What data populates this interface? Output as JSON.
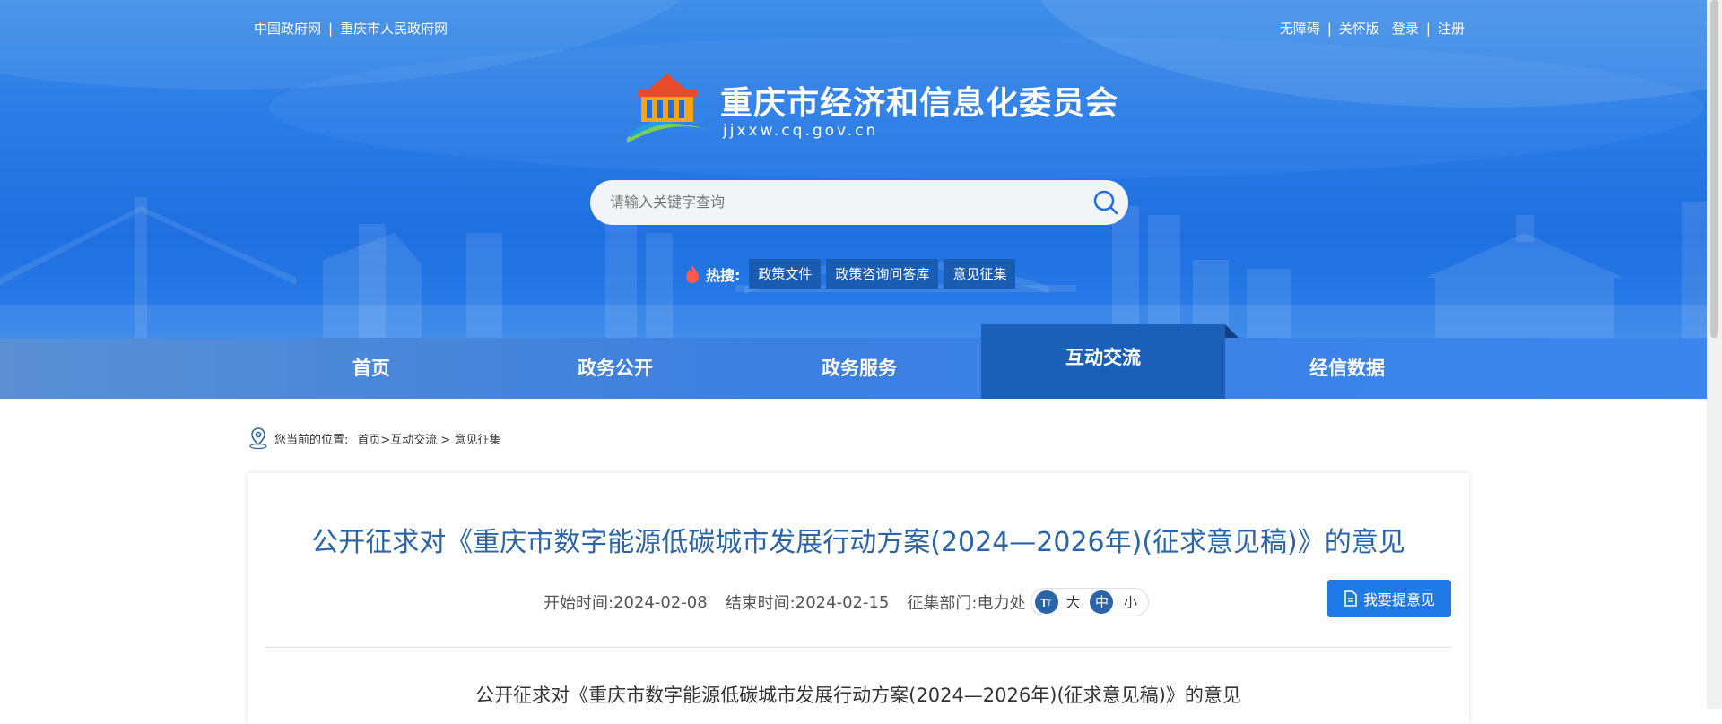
{
  "top_left_links": [
    "中国政府网",
    "重庆市人民政府网"
  ],
  "top_left_sep": "|",
  "top_right_links": [
    "无障碍",
    "关怀版",
    "登录",
    "注册"
  ],
  "site": {
    "title": "重庆市经济和信息化委员会",
    "domain": "jjxxw.cq.gov.cn"
  },
  "search": {
    "placeholder": "请输入关键字查询"
  },
  "hot": {
    "label": "热搜:",
    "tags": [
      "政策文件",
      "政策咨询问答库",
      "意见征集"
    ]
  },
  "nav": {
    "items": [
      "首页",
      "政务公开",
      "政务服务",
      "互动交流",
      "经信数据"
    ],
    "active_index": 3
  },
  "breadcrumb": {
    "prefix": "您当前的位置:",
    "path": "首页>互动交流 > 意见征集"
  },
  "article": {
    "title": "公开征求对《重庆市数字能源低碳城市发展行动方案(2024—2026年)(征求意见稿)》的意见",
    "start_label": "开始时间:",
    "start_value": "2024-02-08",
    "end_label": "结束时间:",
    "end_value": "2024-02-15",
    "dept_label": "征集部门:",
    "dept_value": "电力处",
    "font_sizes": [
      "大",
      "中",
      "小"
    ],
    "font_active": "中",
    "submit_label": "我要提意见",
    "body_title": "公开征求对《重庆市数字能源低碳城市发展行动方案(2024—2026年)(征求意见稿)》的意见"
  },
  "colors": {
    "header_blue": "#2a7ce6",
    "nav_active": "#1a5fb8",
    "title_blue": "#2b64a8",
    "button_blue": "#1f7ae6"
  }
}
